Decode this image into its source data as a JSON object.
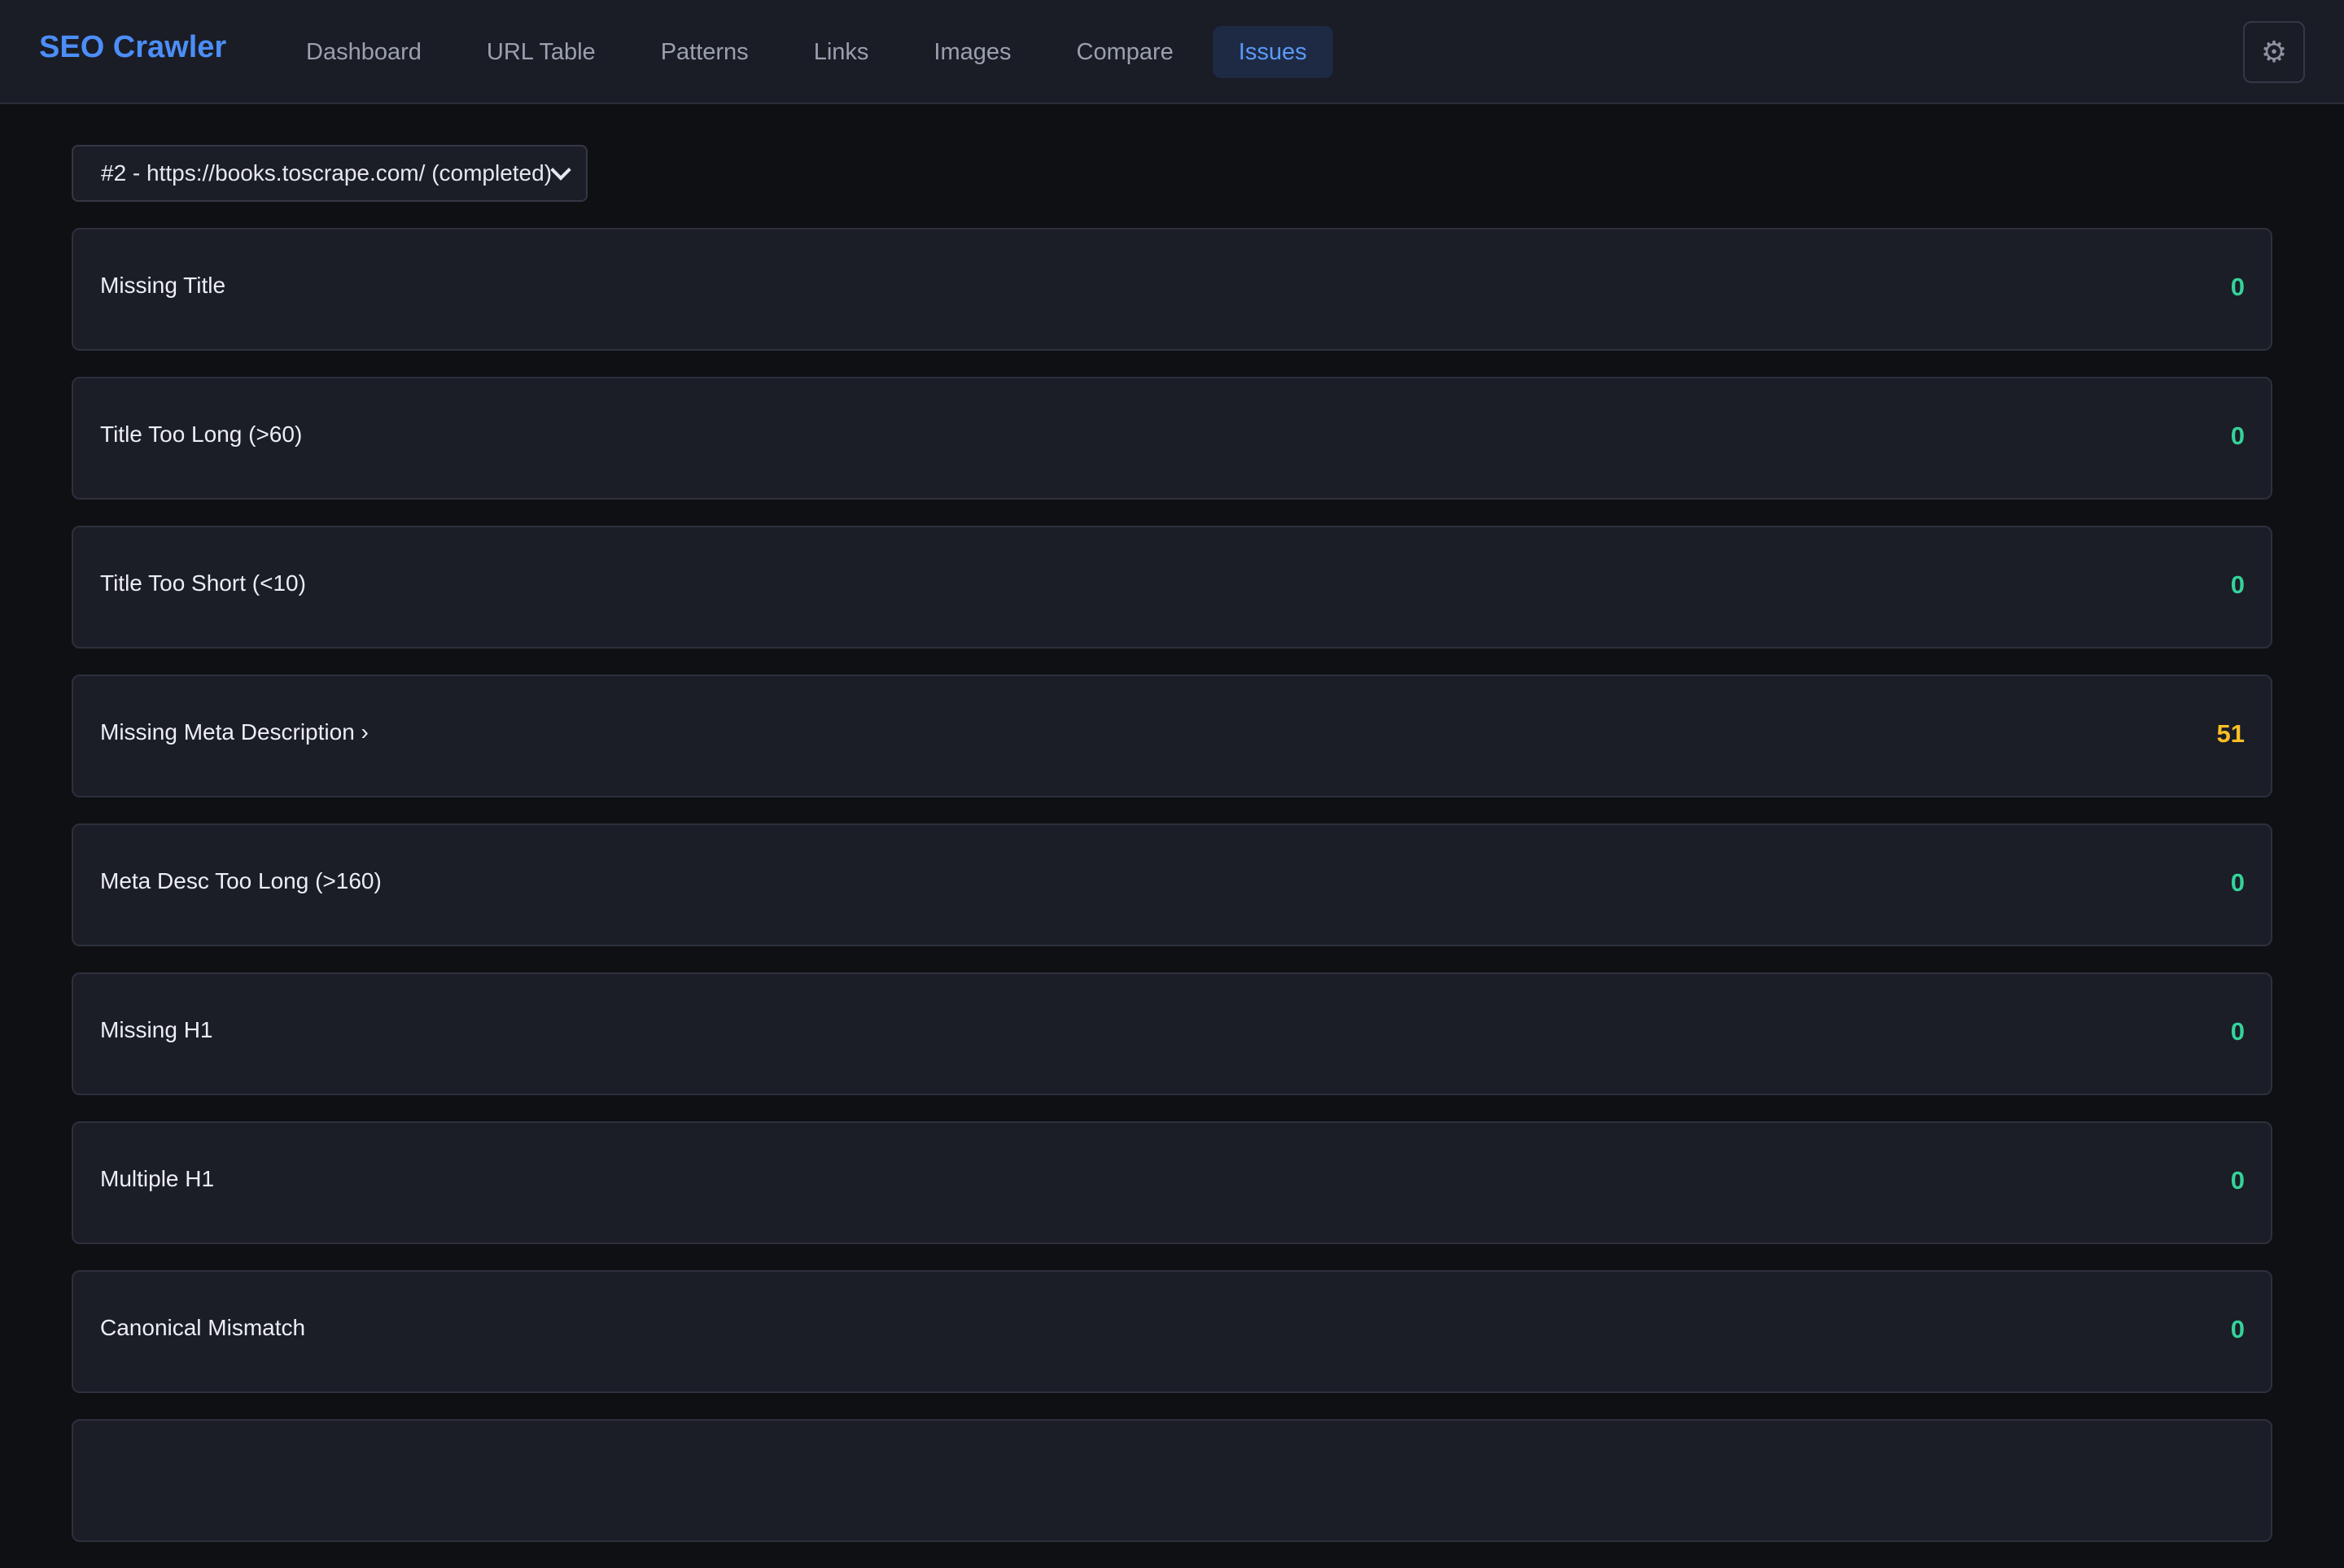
{
  "app": {
    "brand": "SEO Crawler"
  },
  "nav": {
    "items": [
      {
        "label": "Dashboard",
        "active": false
      },
      {
        "label": "URL Table",
        "active": false
      },
      {
        "label": "Patterns",
        "active": false
      },
      {
        "label": "Links",
        "active": false
      },
      {
        "label": "Images",
        "active": false
      },
      {
        "label": "Compare",
        "active": false
      },
      {
        "label": "Issues",
        "active": true
      }
    ]
  },
  "settings": {
    "icon": "gear-icon",
    "glyph": "⚙"
  },
  "crawl_select": {
    "selected": "#2 - https://books.toscrape.com/ (completed)"
  },
  "issues": [
    {
      "label": "Missing Title",
      "count": "0",
      "status": "ok"
    },
    {
      "label": "Title Too Long (>60)",
      "count": "0",
      "status": "ok"
    },
    {
      "label": "Title Too Short (<10)",
      "count": "0",
      "status": "ok"
    },
    {
      "label": "Missing Meta Description ›",
      "count": "51",
      "status": "warn"
    },
    {
      "label": "Meta Desc Too Long (>160)",
      "count": "0",
      "status": "ok"
    },
    {
      "label": "Missing H1",
      "count": "0",
      "status": "ok"
    },
    {
      "label": "Multiple H1",
      "count": "0",
      "status": "ok"
    },
    {
      "label": "Canonical Mismatch",
      "count": "0",
      "status": "ok"
    },
    {
      "label": "",
      "count": "",
      "status": "ok"
    }
  ],
  "colors": {
    "accent": "#4c8ef7",
    "ok": "#34d399",
    "warn": "#fbbf24",
    "background": "#0f1014",
    "card": "#1b1d27"
  }
}
